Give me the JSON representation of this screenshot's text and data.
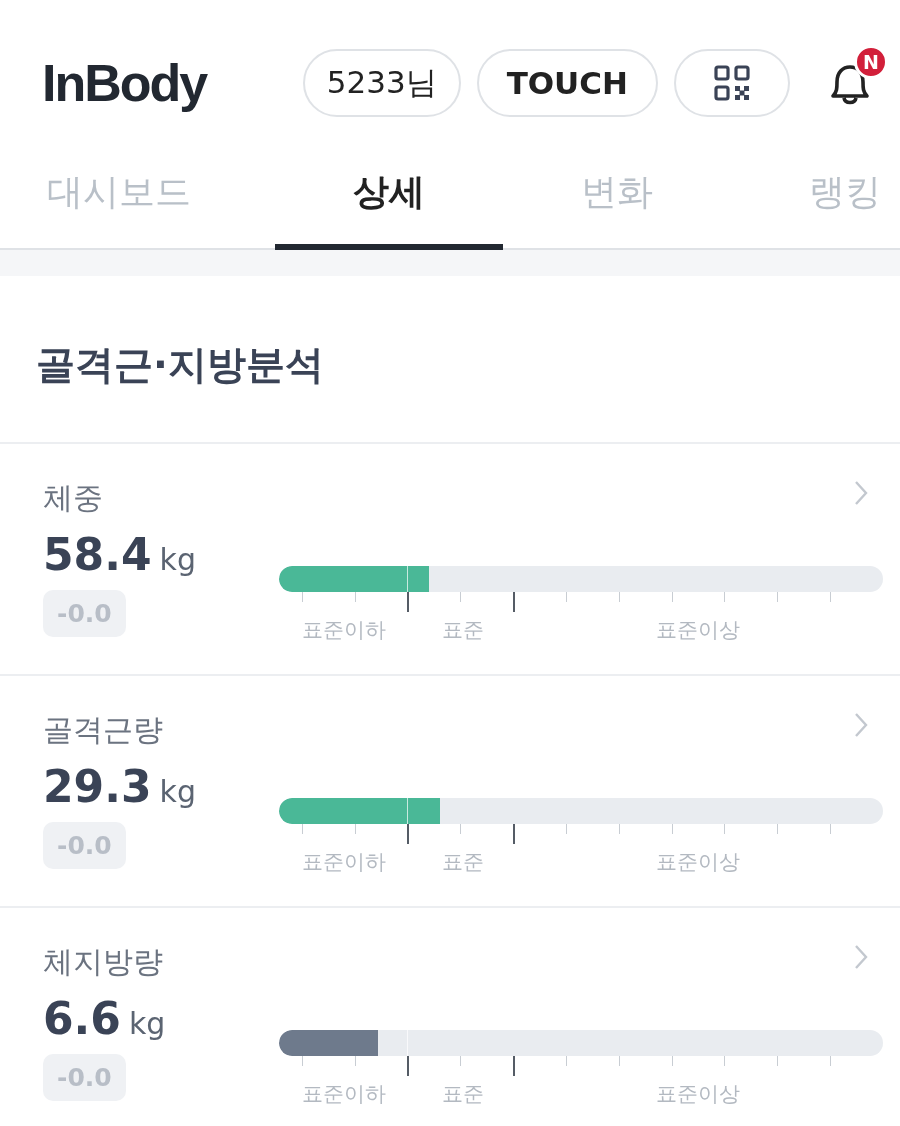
{
  "header": {
    "logo": "InBody",
    "user_button": "5233님",
    "touch_button": "TOUCH",
    "notification_badge": "N"
  },
  "tabs": [
    {
      "label": "대시보드",
      "selected": false
    },
    {
      "label": "상세",
      "selected": true
    },
    {
      "label": "변화",
      "selected": false
    },
    {
      "label": "랭킹",
      "selected": false
    }
  ],
  "section_title": "골격근·지방분석",
  "metrics": [
    {
      "name": "체중",
      "value": "58.4",
      "unit": "kg",
      "change": "-0.0",
      "level": 0.248,
      "color": "#4ab897",
      "scale": [
        "표준이하",
        "표준",
        "표준이상"
      ]
    },
    {
      "name": "골격근량",
      "value": "29.3",
      "unit": "kg",
      "change": "-0.0",
      "level": 0.267,
      "color": "#4ab897",
      "scale": [
        "표준이하",
        "표준",
        "표준이상"
      ]
    },
    {
      "name": "체지방량",
      "value": "6.6",
      "unit": "kg",
      "change": "-0.0",
      "level": 0.164,
      "color": "#6e7a8c",
      "scale": [
        "표준이하",
        "표준",
        "표준이상"
      ]
    }
  ]
}
